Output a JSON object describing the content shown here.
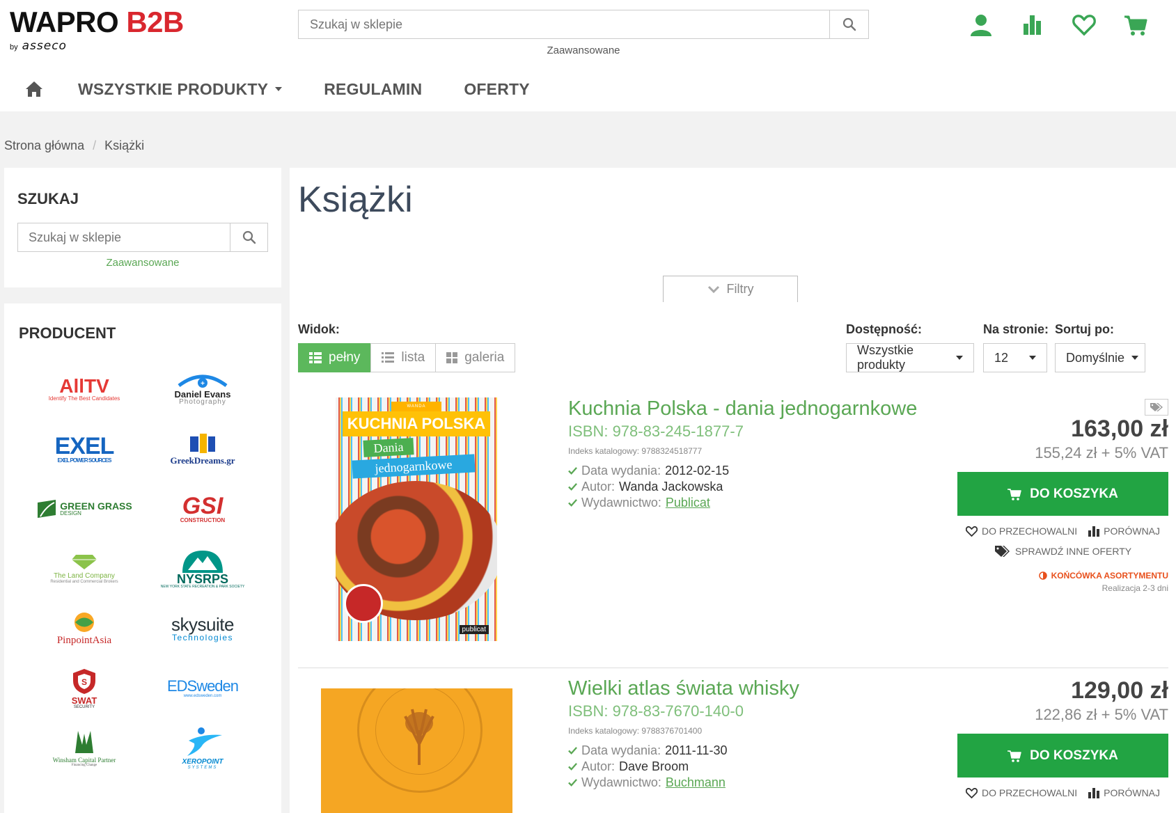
{
  "header": {
    "logo_main_1": "WAPRO",
    "logo_main_2": "B2B",
    "logo_by": "by",
    "logo_brand": "asseco",
    "search_placeholder": "Szukaj w sklepie",
    "advanced": "Zaawansowane",
    "icons": [
      "user-icon",
      "compare-chart-icon",
      "heart-icon",
      "cart-icon"
    ]
  },
  "nav": {
    "items": [
      "WSZYSTKIE PRODUKTY",
      "REGULAMIN",
      "OFERTY"
    ]
  },
  "breadcrumb": [
    "Strona główna",
    "/",
    "Książki"
  ],
  "sidebar": {
    "search_title": "SZUKAJ",
    "search_placeholder": "Szukaj w sklepie",
    "advanced": "Zaawansowane",
    "producer_title": "PRODUCENT",
    "brands": [
      {
        "name": "AllTV",
        "sub": "Identify The Best Candidates",
        "color": "#e53935"
      },
      {
        "name": "Daniel Evans",
        "sub": "Photography",
        "color": "#1e88e5"
      },
      {
        "name": "EXEL",
        "sub": "EXEL POWER SOURCES",
        "color": "#1565c0"
      },
      {
        "name": "GreekDreams.gr",
        "sub": "",
        "color": "#1a3a8a"
      },
      {
        "name": "GREEN GRASS",
        "sub": "DESIGN",
        "color": "#2e7d32"
      },
      {
        "name": "GSI",
        "sub": "CONSTRUCTION",
        "color": "#d32f2f"
      },
      {
        "name": "The Land Company",
        "sub": "Residential and Commercial Brokers",
        "color": "#7cb342"
      },
      {
        "name": "NYSRPS",
        "sub": "NEW YORK STATE RECREATION & PARK SOCIETY",
        "color": "#00796b"
      },
      {
        "name": "PinpointAsia",
        "sub": "",
        "color": "#c62828"
      },
      {
        "name": "skysuite",
        "sub": "Technologies",
        "color": "#263238"
      },
      {
        "name": "SWAT",
        "sub": "SECURITY",
        "color": "#c62828"
      },
      {
        "name": "EDSweden",
        "sub": "www.edsweden.com",
        "color": "#1e88e5"
      },
      {
        "name": "Winsham Capital Partner",
        "sub": "Financing Change",
        "color": "#2e7d32"
      },
      {
        "name": "XEROPOINT",
        "sub": "SYSTEMS",
        "color": "#0288d1"
      }
    ]
  },
  "main": {
    "title": "Książki",
    "filters": "Filtry",
    "view_label": "Widok:",
    "views": [
      "pełny",
      "lista",
      "galeria"
    ],
    "availability_label": "Dostępność:",
    "availability_value": "Wszystkie produkty",
    "per_page_label": "Na stronie:",
    "per_page_value": "12",
    "sort_label": "Sortuj po:",
    "sort_value": "Domyślnie"
  },
  "products": [
    {
      "title": "Kuchnia Polska - dania jednogarnkowe",
      "isbn": "ISBN: 978-83-245-1877-7",
      "index": "Indeks katalogowy: 9788324518777",
      "date_label": "Data wydania:",
      "date": "2012-02-15",
      "author_label": "Autor:",
      "author": "Wanda Jackowska",
      "publisher_label": "Wydawnictwo:",
      "publisher": "Publicat",
      "price": "163,00 zł",
      "price_net": "155,24 zł + 5% VAT",
      "cart": "DO KOSZYKA",
      "wishlist": "DO PRZECHOWALNI",
      "compare": "PORÓWNAJ",
      "other_offers": "SPRAWDŹ INNE OFERTY",
      "stock": "KOŃCÓWKA ASORTYMENTU",
      "realization": "Realizacja 2-3 dni",
      "cover_top": "WANDA JACKOWSKA",
      "cover_title": "KUCHNIA POLSKA",
      "cover_sub1": "Dania",
      "cover_sub2": "jednogarnkowe",
      "cover_publisher": "publicat"
    },
    {
      "title": "Wielki atlas świata whisky",
      "isbn": "ISBN: 978-83-7670-140-0",
      "index": "Indeks katalogowy: 9788376701400",
      "date_label": "Data wydania:",
      "date": "2011-11-30",
      "author_label": "Autor:",
      "author": "Dave Broom",
      "publisher_label": "Wydawnictwo:",
      "publisher": "Buchmann",
      "price": "129,00 zł",
      "price_net": "122,86 zł + 5% VAT",
      "cart": "DO KOSZYKA",
      "wishlist": "DO PRZECHOWALNI",
      "compare": "PORÓWNAJ"
    }
  ],
  "colors": {
    "green": "#5aa754",
    "cart_green": "#22a443",
    "active_view": "#5cb85c",
    "brand_red": "#d9272e"
  }
}
